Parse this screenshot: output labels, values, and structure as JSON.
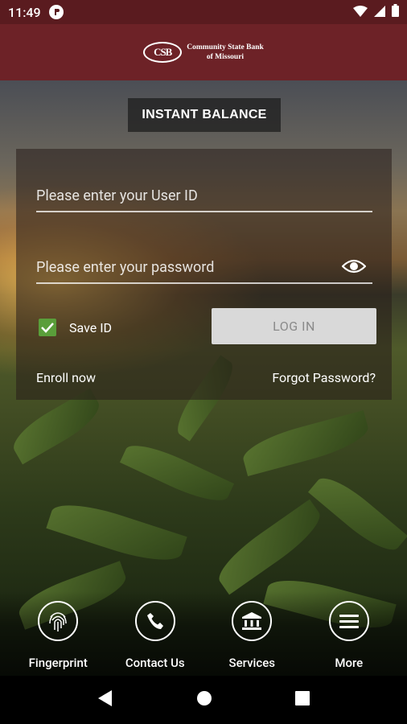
{
  "status_bar": {
    "time": "11:49",
    "app_indicator_icon": "notification-app-icon",
    "icons": [
      "wifi-icon",
      "signal-icon",
      "battery-icon"
    ]
  },
  "header": {
    "logo_mark": "CSB",
    "logo_name_line1": "Community State Bank",
    "logo_name_line2": "of Missouri",
    "brand_color": "#6d2227"
  },
  "instant_balance_label": "INSTANT BALANCE",
  "login": {
    "user_id_placeholder": "Please enter your User ID",
    "password_placeholder": "Please enter your password",
    "save_id_label": "Save ID",
    "save_id_checked": true,
    "login_button_label": "LOG IN",
    "enroll_label": "Enroll now",
    "forgot_label": "Forgot Password?",
    "checkbox_color": "#5a9e3a"
  },
  "bottom_nav": {
    "items": [
      {
        "label": "Fingerprint",
        "icon": "fingerprint-icon"
      },
      {
        "label": "Contact Us",
        "icon": "phone-icon"
      },
      {
        "label": "Services",
        "icon": "bank-icon"
      },
      {
        "label": "More",
        "icon": "menu-icon"
      }
    ]
  },
  "android_nav": {
    "icons": [
      "back-icon",
      "home-icon",
      "recents-icon"
    ]
  }
}
